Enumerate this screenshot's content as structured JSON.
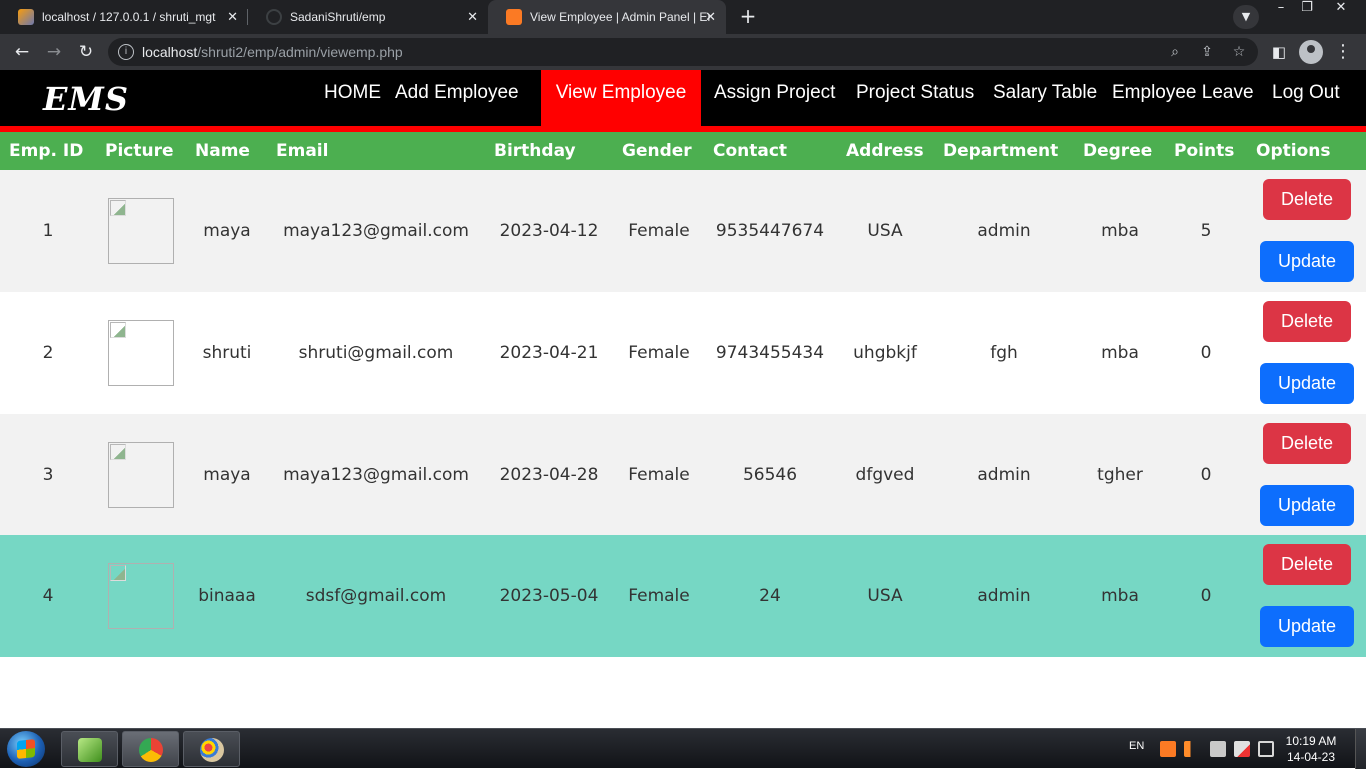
{
  "browser": {
    "tabs": [
      {
        "title": "localhost / 127.0.0.1 / shruti_mgt",
        "favicon": "phpmyadmin-icon"
      },
      {
        "title": "SadaniShruti/emp",
        "favicon": "github-icon"
      },
      {
        "title": "View Employee | Admin Panel | Em",
        "favicon": "xampp-icon",
        "active": true
      }
    ],
    "url_host": "localhost",
    "url_path": "/shruti2/emp/admin/viewemp.php"
  },
  "nav": {
    "brand": "EMS",
    "items": [
      "HOME",
      "Add Employee",
      "View Employee",
      "Assign Project",
      "Project Status",
      "Salary Table",
      "Employee Leave",
      "Log Out"
    ],
    "active": "View Employee",
    "colors": {
      "bar": "#000000",
      "active": "#ff0000"
    }
  },
  "table": {
    "headers": [
      "Emp. ID",
      "Picture",
      "Name",
      "Email",
      "Birthday",
      "Gender",
      "Contact",
      "Address",
      "Department",
      "Degree",
      "Points",
      "Options"
    ],
    "header_color": "#4caf50",
    "rows": [
      {
        "id": "1",
        "name": "maya",
        "email": "maya123@gmail.com",
        "birthday": "2023-04-12",
        "gender": "Female",
        "contact": "9535447674",
        "address": "USA",
        "department": "admin",
        "degree": "mba",
        "points": "5"
      },
      {
        "id": "2",
        "name": "shruti",
        "email": "shruti@gmail.com",
        "birthday": "2023-04-21",
        "gender": "Female",
        "contact": "9743455434",
        "address": "uhgbkjf",
        "department": "fgh",
        "degree": "mba",
        "points": "0"
      },
      {
        "id": "3",
        "name": "maya",
        "email": "maya123@gmail.com",
        "birthday": "2023-04-28",
        "gender": "Female",
        "contact": "56546",
        "address": "dfgved",
        "department": "admin",
        "degree": "tgher",
        "points": "0"
      },
      {
        "id": "4",
        "name": "binaaa",
        "email": "sdsf@gmail.com",
        "birthday": "2023-05-04",
        "gender": "Female",
        "contact": "24",
        "address": "USA",
        "department": "admin",
        "degree": "mba",
        "points": "0"
      }
    ],
    "row_colors": [
      "#f2f2f2",
      "#ffffff",
      "#f2f2f2",
      "#76d7c4"
    ],
    "delete_label": "Delete",
    "update_label": "Update",
    "delete_color": "#dc3545",
    "update_color": "#0d6efd"
  },
  "taskbar": {
    "language": "EN",
    "time": "10:19 AM",
    "date": "14-04-23"
  }
}
